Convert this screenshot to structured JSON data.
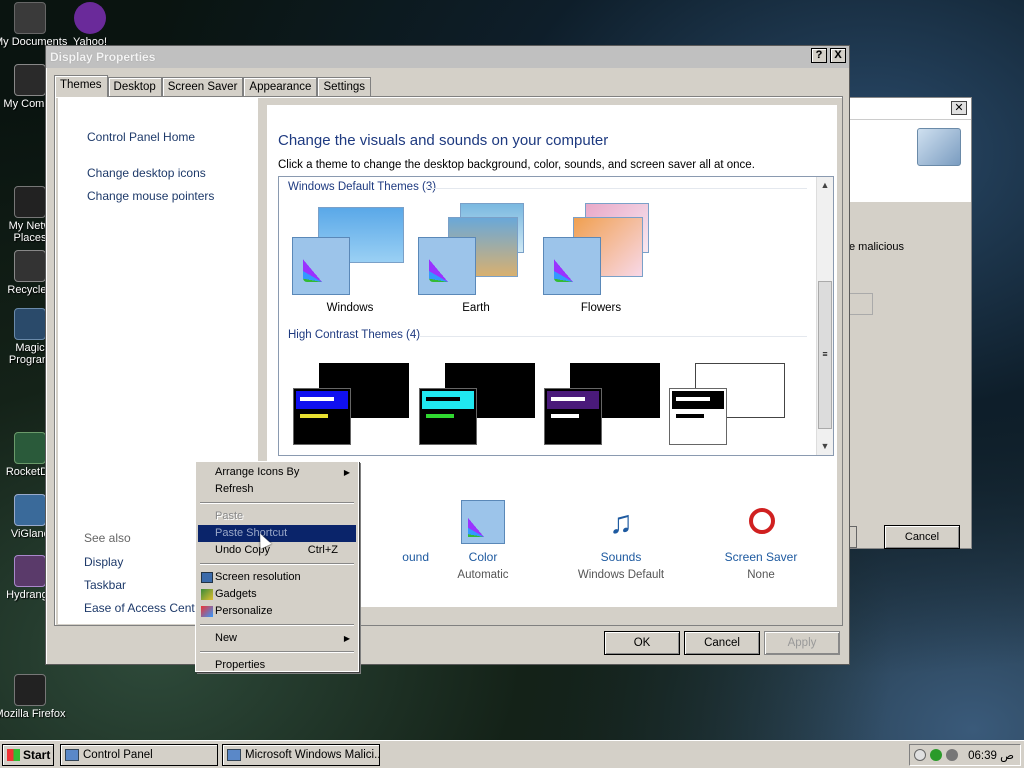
{
  "desktop": {
    "icons": [
      {
        "label": "My Documents"
      },
      {
        "label": "Yahoo!"
      },
      {
        "label": "My Compu"
      },
      {
        "label": "My Netw"
      },
      {
        "label": "Places"
      },
      {
        "label": "Recycle I"
      },
      {
        "label": "Magic"
      },
      {
        "label": "Program"
      },
      {
        "label": "RocketDo"
      },
      {
        "label": "ViGlanc"
      },
      {
        "label": "Hydrange"
      },
      {
        "label": "Mozilla Firefox"
      }
    ]
  },
  "background_window": {
    "text": "e malicious",
    "cancel_label": "Cancel"
  },
  "dialog": {
    "title": "Display Properties",
    "help_label": "?",
    "close_label": "X",
    "tabs": [
      {
        "label": "Themes"
      },
      {
        "label": "Desktop"
      },
      {
        "label": "Screen Saver"
      },
      {
        "label": "Appearance"
      },
      {
        "label": "Settings"
      }
    ],
    "left_links": [
      {
        "label": "Control Panel Home"
      },
      {
        "label": "Change desktop icons"
      },
      {
        "label": "Change mouse pointers"
      }
    ],
    "see_also_label": "See also",
    "see_also": [
      {
        "label": "Display"
      },
      {
        "label": "Taskbar"
      },
      {
        "label": "Ease of Access Center"
      }
    ],
    "heading": "Change the visuals and sounds on your computer",
    "subtext": "Click a theme to change the desktop background, color, sounds, and screen saver all at once.",
    "groups": [
      {
        "label": "Windows Default Themes (3)"
      },
      {
        "label": "High Contrast Themes (4)"
      }
    ],
    "themes": [
      {
        "name": "Windows"
      },
      {
        "name": "Earth"
      },
      {
        "name": "Flowers"
      }
    ],
    "bottom_items": [
      {
        "label": "ound",
        "value": ""
      },
      {
        "label": "Color",
        "value": "Automatic"
      },
      {
        "label": "Sounds",
        "value": "Windows Default"
      },
      {
        "label": "Screen Saver",
        "value": "None"
      }
    ],
    "buttons": {
      "ok": "OK",
      "cancel": "Cancel",
      "apply": "Apply"
    }
  },
  "context_menu": {
    "items": [
      {
        "label": "Arrange Icons By"
      },
      {
        "label": "Refresh"
      },
      {
        "label": "Paste"
      },
      {
        "label": "Paste Shortcut"
      },
      {
        "label": "Undo Copy",
        "shortcut": "Ctrl+Z"
      },
      {
        "label": "Screen resolution"
      },
      {
        "label": "Gadgets"
      },
      {
        "label": "Personalize"
      },
      {
        "label": "New"
      },
      {
        "label": "Properties"
      }
    ]
  },
  "taskbar": {
    "start_label": "Start",
    "tasks": [
      {
        "label": "Control Panel"
      },
      {
        "label": "Microsoft Windows Malici..."
      }
    ],
    "clock": "06:39 ص"
  }
}
